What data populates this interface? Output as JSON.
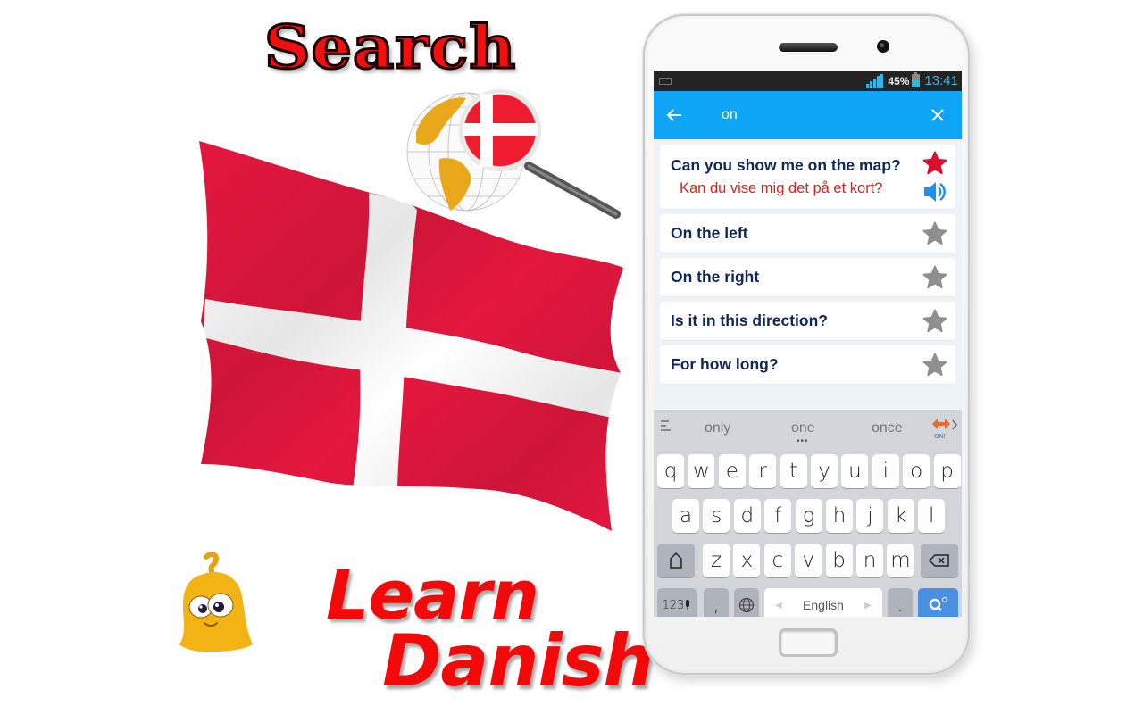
{
  "promo": {
    "heading_top": "Search",
    "heading_bottom_line1": "Learn",
    "heading_bottom_line2": "Danish",
    "flag_colors": {
      "red": "#e4173e",
      "white": "#ffffff"
    }
  },
  "status_bar": {
    "battery": "45%",
    "time": "13:41",
    "accent": "#33b5e5"
  },
  "app_bar": {
    "back_icon": "arrow-left-icon",
    "search_query": "on",
    "clear_icon": "close-icon",
    "color": "#0ea5f7"
  },
  "results": [
    {
      "phrase": "Can you show me on the map?",
      "translation": "Kan du vise mig det på et kort?",
      "favorite": true,
      "expanded": true
    },
    {
      "phrase": "On the left",
      "favorite": false,
      "expanded": false
    },
    {
      "phrase": "On the right",
      "favorite": false,
      "expanded": false
    },
    {
      "phrase": "Is it in this direction?",
      "favorite": false,
      "expanded": false
    },
    {
      "phrase": "For how long?",
      "favorite": false,
      "expanded": false
    }
  ],
  "colors": {
    "phrase": "#0f2657",
    "translation": "#d7241d",
    "star_active": "#d8102c",
    "star_inactive": "#8f8f8f",
    "speaker": "#1e90f0"
  },
  "keyboard": {
    "suggestions": [
      "only",
      "one",
      "once"
    ],
    "suggestion_more": "•••",
    "badge": "ON!",
    "rows": [
      [
        "q",
        "w",
        "e",
        "r",
        "t",
        "y",
        "u",
        "i",
        "o",
        "p"
      ],
      [
        "a",
        "s",
        "d",
        "f",
        "g",
        "h",
        "j",
        "k",
        "l"
      ],
      [
        "z",
        "x",
        "c",
        "v",
        "b",
        "n",
        "m"
      ]
    ],
    "numbers_key": "123",
    "comma_key": ",",
    "space_label": "English",
    "period_key": "."
  }
}
